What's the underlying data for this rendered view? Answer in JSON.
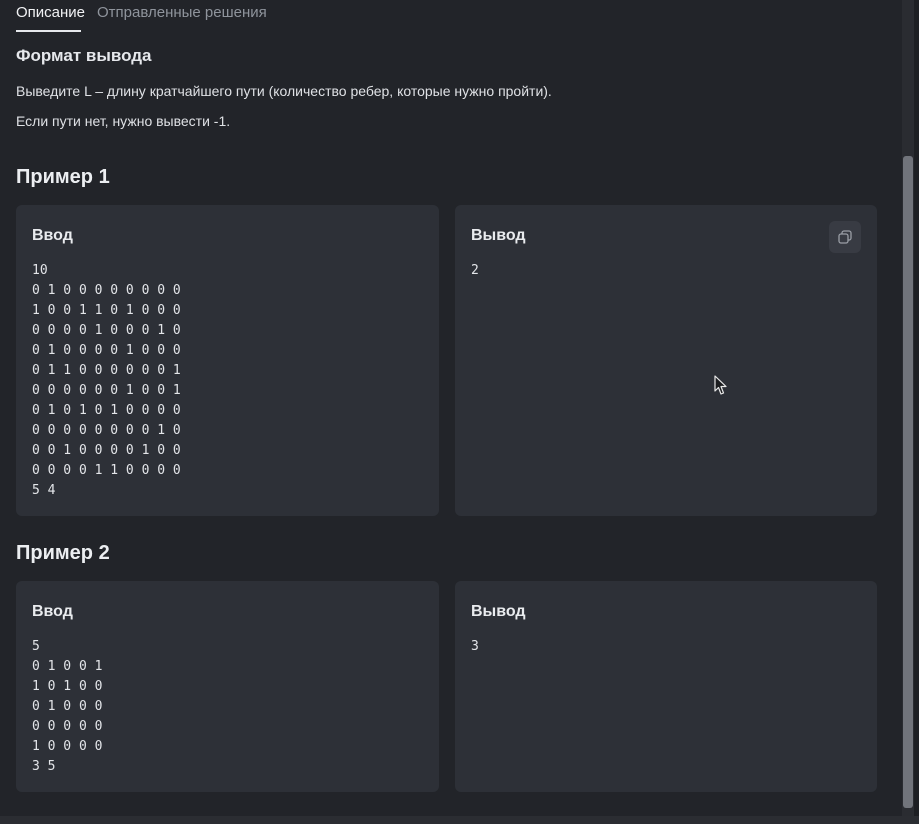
{
  "tabs": [
    {
      "label": "Описание",
      "active": true
    },
    {
      "label": "Отправленные решения",
      "active": false
    }
  ],
  "output_format": {
    "heading": "Формат вывода",
    "lines": [
      "Выведите L – длину кратчайшего пути (количество ребер, которые нужно пройти).",
      "Если пути нет, нужно вывести -1."
    ]
  },
  "examples": [
    {
      "title": "Пример 1",
      "input_label": "Ввод",
      "input": "10\n0 1 0 0 0 0 0 0 0 0\n1 0 0 1 1 0 1 0 0 0\n0 0 0 0 1 0 0 0 1 0\n0 1 0 0 0 0 1 0 0 0\n0 1 1 0 0 0 0 0 0 1\n0 0 0 0 0 0 1 0 0 1\n0 1 0 1 0 1 0 0 0 0\n0 0 0 0 0 0 0 0 1 0\n0 0 1 0 0 0 0 1 0 0\n0 0 0 0 1 1 0 0 0 0\n5 4",
      "output_label": "Вывод",
      "output": "2",
      "copy_icon": "copy-icon"
    },
    {
      "title": "Пример 2",
      "input_label": "Ввод",
      "input": "5\n0 1 0 0 1\n1 0 1 0 0\n0 1 0 0 0\n0 0 0 0 0\n1 0 0 0 0\n3 5",
      "output_label": "Вывод",
      "output": "3"
    }
  ],
  "colors": {
    "background": "#222429",
    "card": "#2d3037",
    "text": "#e6e8ec",
    "muted": "#8f949c",
    "scrollbar_thumb": "#71747b"
  }
}
